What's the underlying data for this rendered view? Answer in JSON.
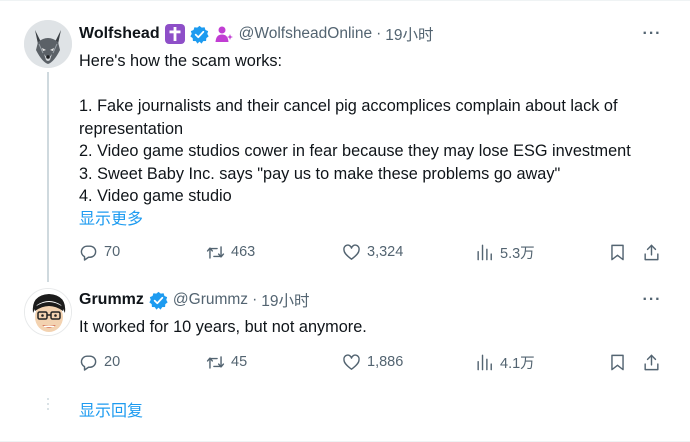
{
  "colors": {
    "text_primary": "#0f1419",
    "text_secondary": "#536471",
    "link": "#1d9bf0",
    "verified": "#1d9bf0",
    "cross_badge": "#8e4fc8",
    "divider": "#eff3f4"
  },
  "tweets": [
    {
      "display_name": "Wolfshead",
      "emoji_badges": [
        "latin-cross-emoji",
        "verified-badge",
        "person-with-sparkles-emoji"
      ],
      "handle": "@WolfsheadOnline",
      "separator": "·",
      "time": "19小时",
      "more_label": "···",
      "text": "Here's how the scam works:\n\n1. Fake journalists and their cancel pig accomplices complain about lack of representation\n2. Video game studios cower in fear because they may lose ESG investment\n3. Sweet Baby Inc. says \"pay us to make these problems go away\"\n4. Video game studio",
      "show_more": "显示更多",
      "stats": {
        "replies": "70",
        "retweets": "463",
        "likes": "3,324",
        "views": "5.3万"
      }
    },
    {
      "display_name": "Grummz",
      "emoji_badges": [
        "verified-badge"
      ],
      "handle": "@Grummz",
      "separator": "·",
      "time": "19小时",
      "more_label": "···",
      "text": "It worked for 10 years, but not anymore.",
      "stats": {
        "replies": "20",
        "retweets": "45",
        "likes": "1,886",
        "views": "4.1万"
      }
    }
  ],
  "show_replies": "显示回复"
}
